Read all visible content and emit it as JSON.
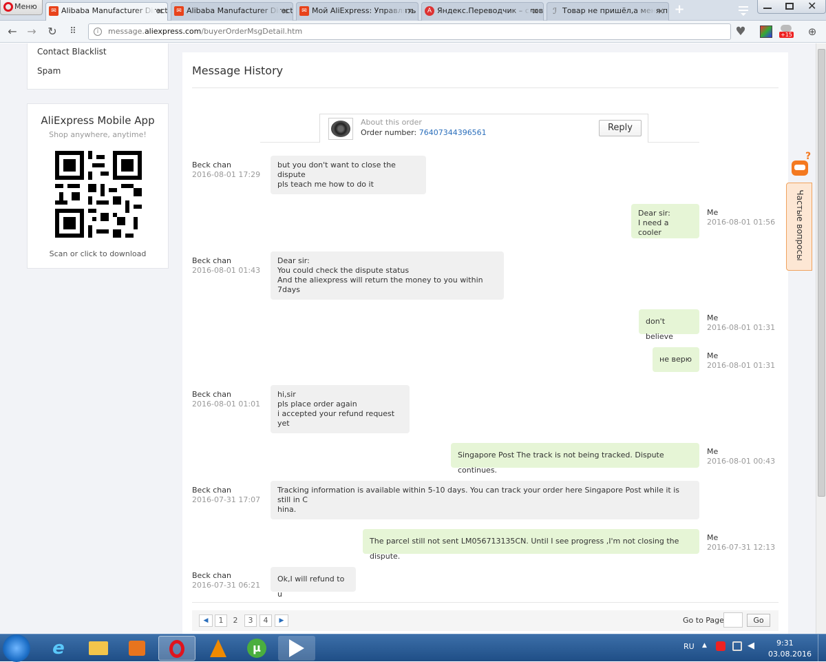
{
  "browser": {
    "menu_label": "Меню",
    "tabs": [
      {
        "label": "Alibaba Manufacturer Directo",
        "active": true
      },
      {
        "label": "Alibaba Manufacturer Directo",
        "active": false
      },
      {
        "label": "Мой AliExpress: Управлять за",
        "active": false
      },
      {
        "label": "Яндекс.Переводчик – слова",
        "active": false
      },
      {
        "label": "Товар не пришёл,а меня пр",
        "active": false
      }
    ],
    "new_tab": "+",
    "address_prefix": "message.",
    "address_domain": "aliexpress.com",
    "address_path": "/buyerOrderMsgDetail.htm",
    "badge_count": "+15"
  },
  "sidebar": {
    "links": [
      "Contact Blacklist",
      "Spam"
    ],
    "app_title": "AliExpress Mobile App",
    "app_subtitle": "Shop anywhere, anytime!",
    "qr_caption": "Scan or click to download"
  },
  "main": {
    "title": "Message History",
    "order": {
      "about_label": "About this order",
      "number_label": "Order number:",
      "number_value": "76407344396561",
      "reply_label": "Reply"
    },
    "messages": [
      {
        "from": "Beck chan",
        "time": "2016-08-01 17:29",
        "side": "them",
        "lines": [
          "but you don't want to close the dispute",
          "pls teach me how to do it"
        ]
      },
      {
        "from": "Me",
        "time": "2016-08-01 01:56",
        "side": "me",
        "lines": [
          "Dear sir:",
          "I need a cooler"
        ]
      },
      {
        "from": "Beck chan",
        "time": "2016-08-01 01:43",
        "side": "them",
        "lines": [
          "Dear sir:",
          "You could check the dispute status",
          "And the aliexpress will return the money to you within 7days"
        ]
      },
      {
        "from": "Me",
        "time": "2016-08-01 01:31",
        "side": "me",
        "lines": [
          "don't believe"
        ]
      },
      {
        "from": "Me",
        "time": "2016-08-01 01:31",
        "side": "me",
        "lines": [
          "не верю"
        ]
      },
      {
        "from": "Beck chan",
        "time": "2016-08-01 01:01",
        "side": "them",
        "lines": [
          "hi,sir",
          "pls place order again",
          "i accepted your refund request yet"
        ]
      },
      {
        "from": "Me",
        "time": "2016-08-01 00:43",
        "side": "me",
        "lines": [
          "Singapore Post The track is not being tracked. Dispute continues."
        ]
      },
      {
        "from": "Beck chan",
        "time": "2016-07-31 17:07",
        "side": "them",
        "lines": [
          "Tracking information is available within 5-10 days. You can track your order here Singapore Post while it is still in C",
          "hina."
        ]
      },
      {
        "from": "Me",
        "time": "2016-07-31 12:13",
        "side": "me",
        "lines": [
          "The parcel still not sent LM056713135CN. Until I see progress ,I'm not closing the dispute."
        ]
      },
      {
        "from": "Beck chan",
        "time": "2016-07-31 06:21",
        "side": "them",
        "lines": [
          "Ok,I will refund to u"
        ]
      }
    ],
    "pagination": {
      "pages": [
        "1",
        "2",
        "3",
        "4"
      ],
      "goto_label": "Go to Page",
      "go_button": "Go"
    }
  },
  "help_tab": {
    "label": "Частые вопросы"
  },
  "taskbar": {
    "lang": "RU",
    "time": "9:31",
    "date": "03.08.2016"
  }
}
